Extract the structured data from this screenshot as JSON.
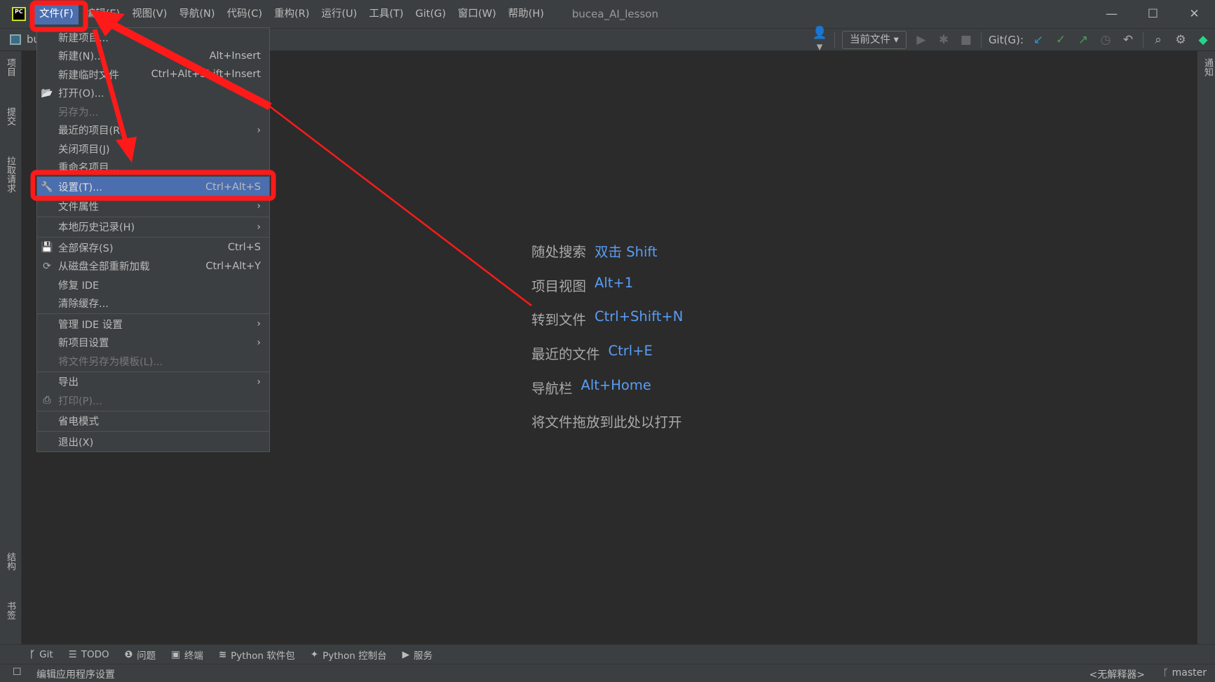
{
  "app": {
    "logo": "PC",
    "title": "bucea_AI_lesson",
    "project": "bu"
  },
  "menubar": [
    "文件(F)",
    "编辑(E)",
    "视图(V)",
    "导航(N)",
    "代码(C)",
    "重构(R)",
    "运行(U)",
    "工具(T)",
    "Git(G)",
    "窗口(W)",
    "帮助(H)"
  ],
  "window_controls": {
    "minimize": "—",
    "maximize": "☐",
    "close": "✕"
  },
  "toolbar": {
    "run_config": "当前文件",
    "git_label": "Git(G):"
  },
  "file_menu": [
    {
      "label": "新建项目...",
      "shortcut": ""
    },
    {
      "label": "新建(N)...",
      "shortcut": "Alt+Insert"
    },
    {
      "label": "新建临时文件",
      "shortcut": "Ctrl+Alt+Shift+Insert"
    },
    {
      "label": "打开(O)...",
      "shortcut": "",
      "icon": "folder-icon"
    },
    {
      "label": "另存为...",
      "shortcut": "",
      "disabled": true
    },
    {
      "label": "最近的项目(R)",
      "shortcut": "",
      "submenu": true
    },
    {
      "label": "关闭项目(J)",
      "shortcut": ""
    },
    {
      "label": "重命名项目...",
      "shortcut": ""
    },
    {
      "label": "设置(T)...",
      "shortcut": "Ctrl+Alt+S",
      "icon": "wrench-icon",
      "highlighted": true
    },
    {
      "label": "文件属性",
      "shortcut": "",
      "submenu": true
    },
    {
      "label": "本地历史记录(H)",
      "shortcut": "",
      "submenu": true
    },
    {
      "label": "全部保存(S)",
      "shortcut": "Ctrl+S",
      "icon": "save-icon"
    },
    {
      "label": "从磁盘全部重新加载",
      "shortcut": "Ctrl+Alt+Y",
      "icon": "reload-icon"
    },
    {
      "label": "修复 IDE",
      "shortcut": ""
    },
    {
      "label": "清除缓存...",
      "shortcut": ""
    },
    {
      "label": "管理 IDE 设置",
      "shortcut": "",
      "submenu": true
    },
    {
      "label": "新项目设置",
      "shortcut": "",
      "submenu": true
    },
    {
      "label": "将文件另存为模板(L)...",
      "shortcut": "",
      "disabled": true
    },
    {
      "label": "导出",
      "shortcut": "",
      "submenu": true
    },
    {
      "label": "打印(P)...",
      "shortcut": "",
      "icon": "print-icon",
      "disabled": true
    },
    {
      "label": "省电模式",
      "shortcut": ""
    },
    {
      "label": "退出(X)",
      "shortcut": ""
    }
  ],
  "hints": [
    {
      "label": "随处搜索",
      "key": "双击 Shift"
    },
    {
      "label": "项目视图",
      "key": "Alt+1"
    },
    {
      "label": "转到文件",
      "key": "Ctrl+Shift+N"
    },
    {
      "label": "最近的文件",
      "key": "Ctrl+E"
    },
    {
      "label": "导航栏",
      "key": "Alt+Home"
    },
    {
      "label": "将文件拖放到此处以打开",
      "key": ""
    }
  ],
  "left_tools": [
    "项目",
    "提交",
    "拉取请求",
    "结构",
    "书签"
  ],
  "right_tools": [
    "通知"
  ],
  "bottom_tools": [
    "Git",
    "TODO",
    "问题",
    "终端",
    "Python 软件包",
    "Python 控制台",
    "服务"
  ],
  "status": {
    "message": "编辑应用程序设置",
    "interpreter": "<无解释器>",
    "branch": "master"
  },
  "colors": {
    "accent": "#4b6eaf",
    "link": "#589df6",
    "annotation": "#ff1a1a"
  }
}
